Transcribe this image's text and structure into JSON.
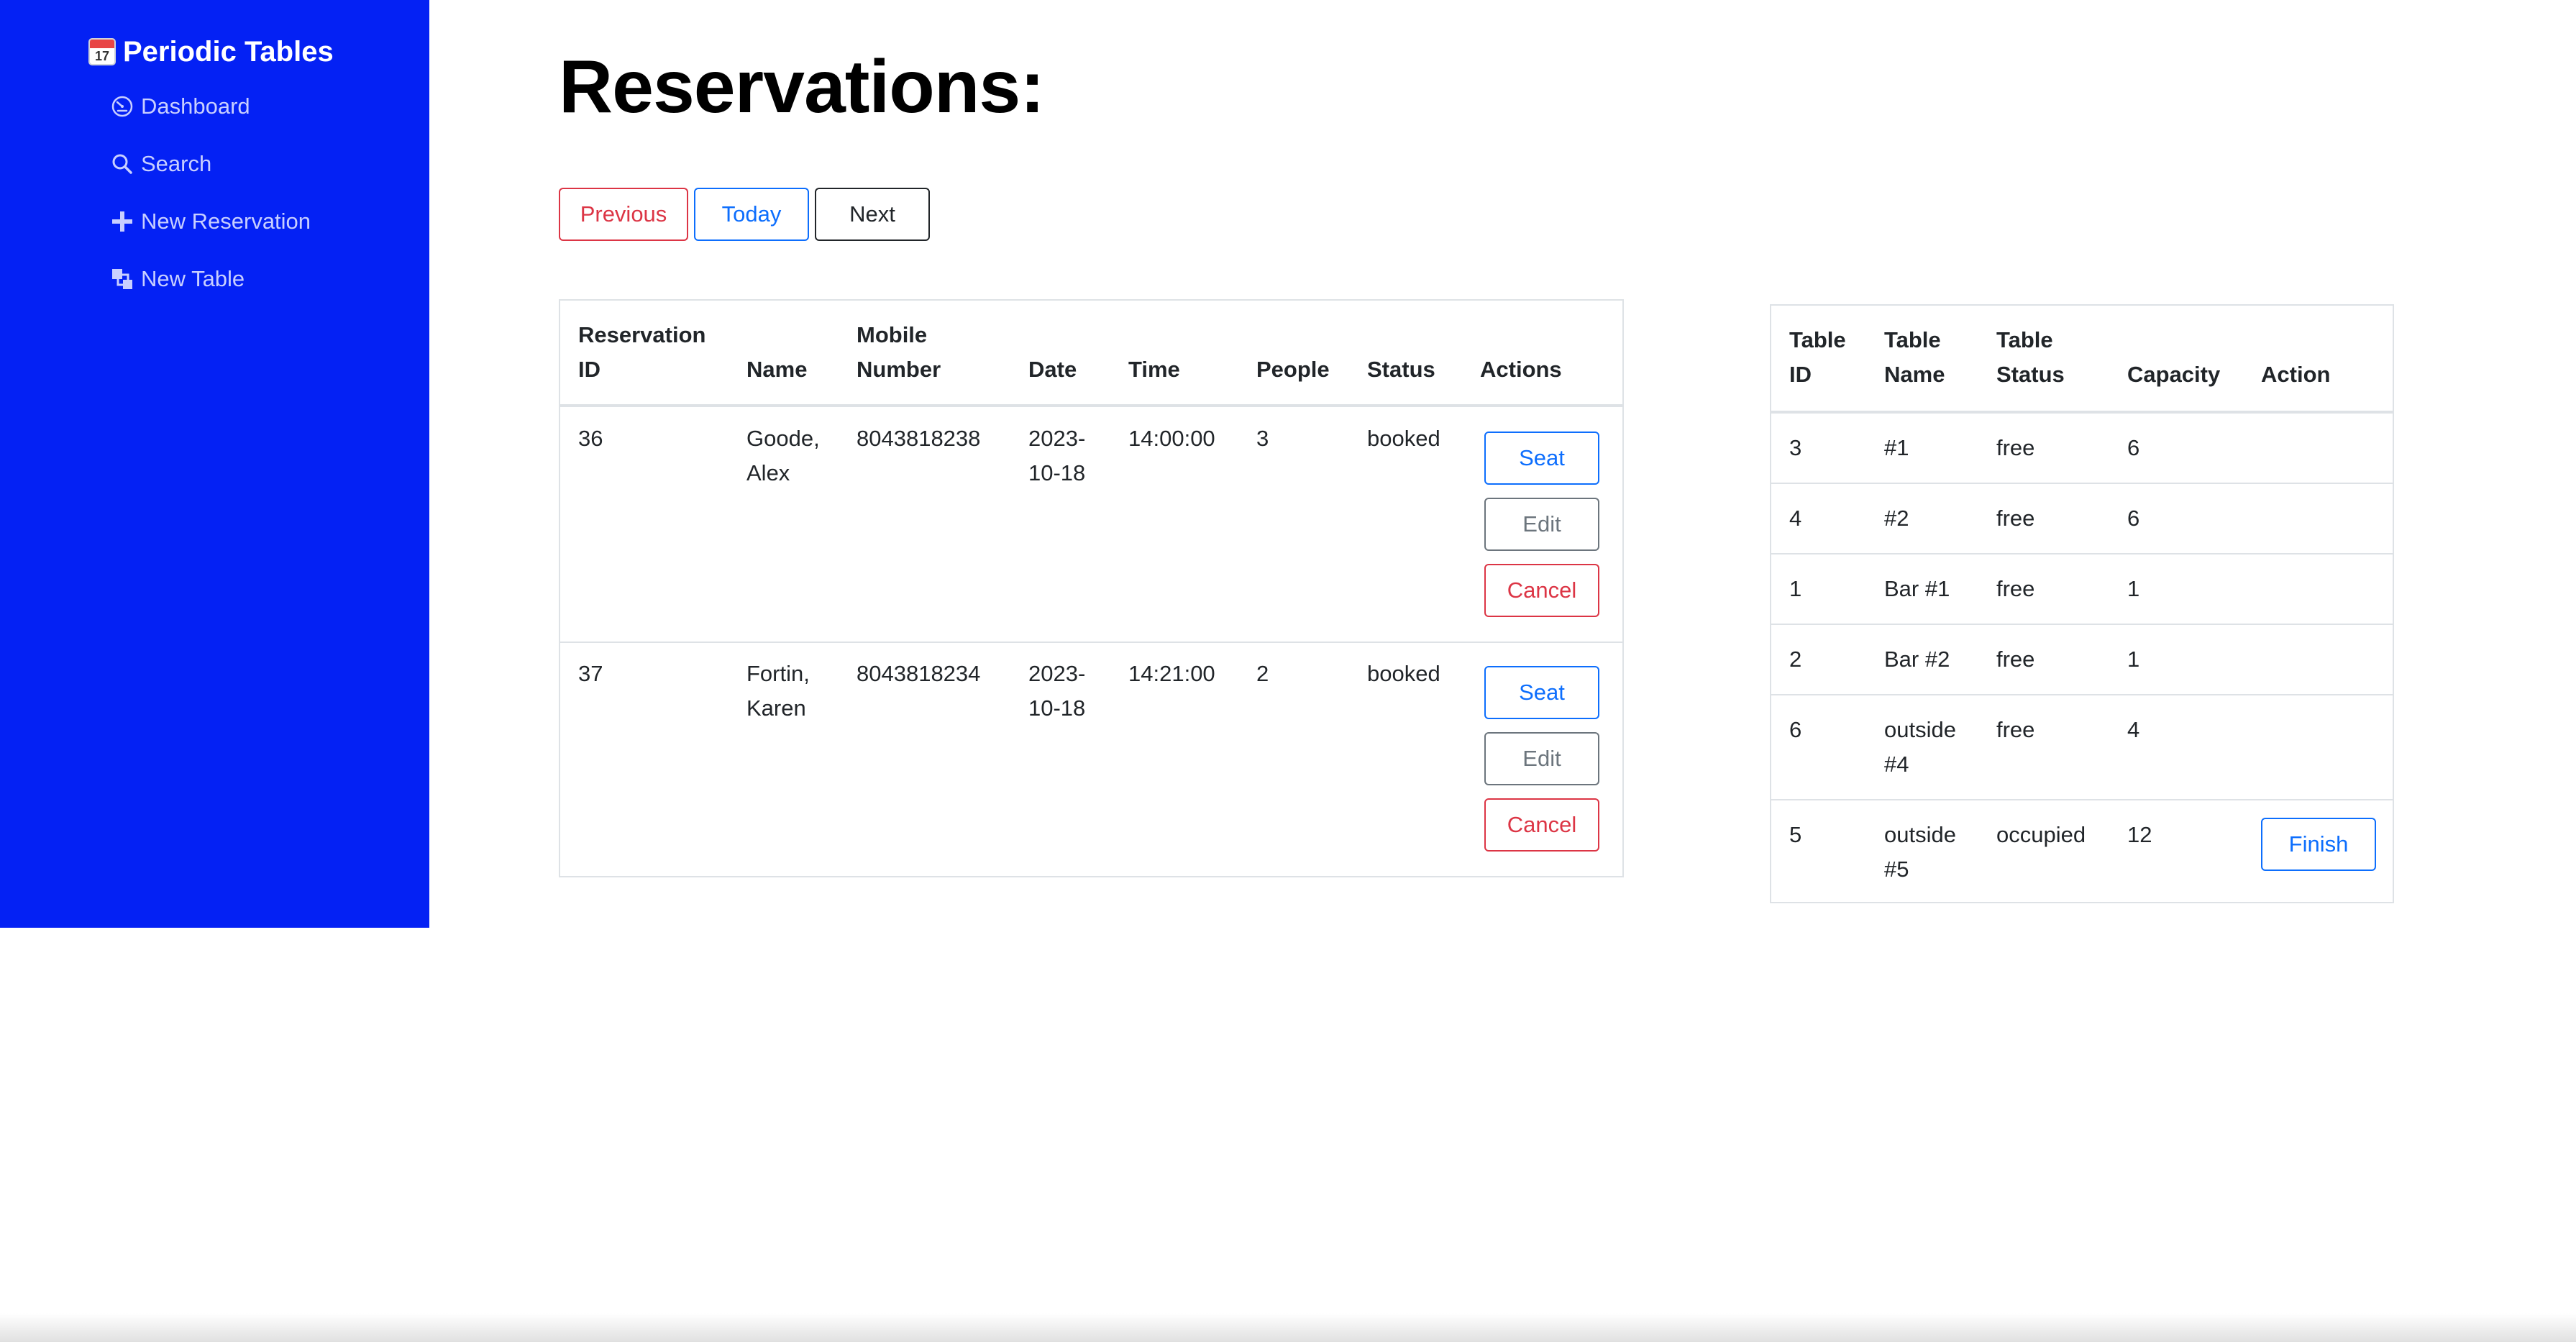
{
  "app": {
    "brand_icon_day": "17",
    "brand": "Periodic Tables",
    "sidebar_color": "#0421f4"
  },
  "nav": [
    {
      "label": "Dashboard",
      "icon": "dashboard-icon"
    },
    {
      "label": "Search",
      "icon": "search-icon"
    },
    {
      "label": "New Reservation",
      "icon": "plus-icon"
    },
    {
      "label": "New Table",
      "icon": "layers-icon"
    }
  ],
  "page": {
    "title": "Reservations:"
  },
  "date_nav": {
    "previous": "Previous",
    "today": "Today",
    "next": "Next"
  },
  "reservations": {
    "headers": [
      "Reservation\nID",
      "Name",
      "Mobile\nNumber",
      "Date",
      "Time",
      "People",
      "Status",
      "Actions"
    ],
    "rows": [
      {
        "id": "36",
        "name": "Goode,\nAlex",
        "mobile": "8043818238",
        "date": "2023-\n10-18",
        "time": "14:00:00",
        "people": "3",
        "status": "booked",
        "seat": "Seat",
        "edit": "Edit",
        "cancel": "Cancel"
      },
      {
        "id": "37",
        "name": "Fortin,\nKaren",
        "mobile": "8043818234",
        "date": "2023-\n10-18",
        "time": "14:21:00",
        "people": "2",
        "status": "booked",
        "seat": "Seat",
        "edit": "Edit",
        "cancel": "Cancel"
      }
    ]
  },
  "tables": {
    "headers": [
      "Table\nID",
      "Table\nName",
      "Table\nStatus",
      "Capacity",
      "Action"
    ],
    "rows": [
      {
        "id": "3",
        "name": "#1",
        "status": "free",
        "capacity": "6",
        "action": ""
      },
      {
        "id": "4",
        "name": "#2",
        "status": "free",
        "capacity": "6",
        "action": ""
      },
      {
        "id": "1",
        "name": "Bar #1",
        "status": "free",
        "capacity": "1",
        "action": ""
      },
      {
        "id": "2",
        "name": "Bar #2",
        "status": "free",
        "capacity": "1",
        "action": ""
      },
      {
        "id": "6",
        "name": "outside\n#4",
        "status": "free",
        "capacity": "4",
        "action": ""
      },
      {
        "id": "5",
        "name": "outside\n#5",
        "status": "occupied",
        "capacity": "12",
        "action": "Finish"
      }
    ]
  }
}
